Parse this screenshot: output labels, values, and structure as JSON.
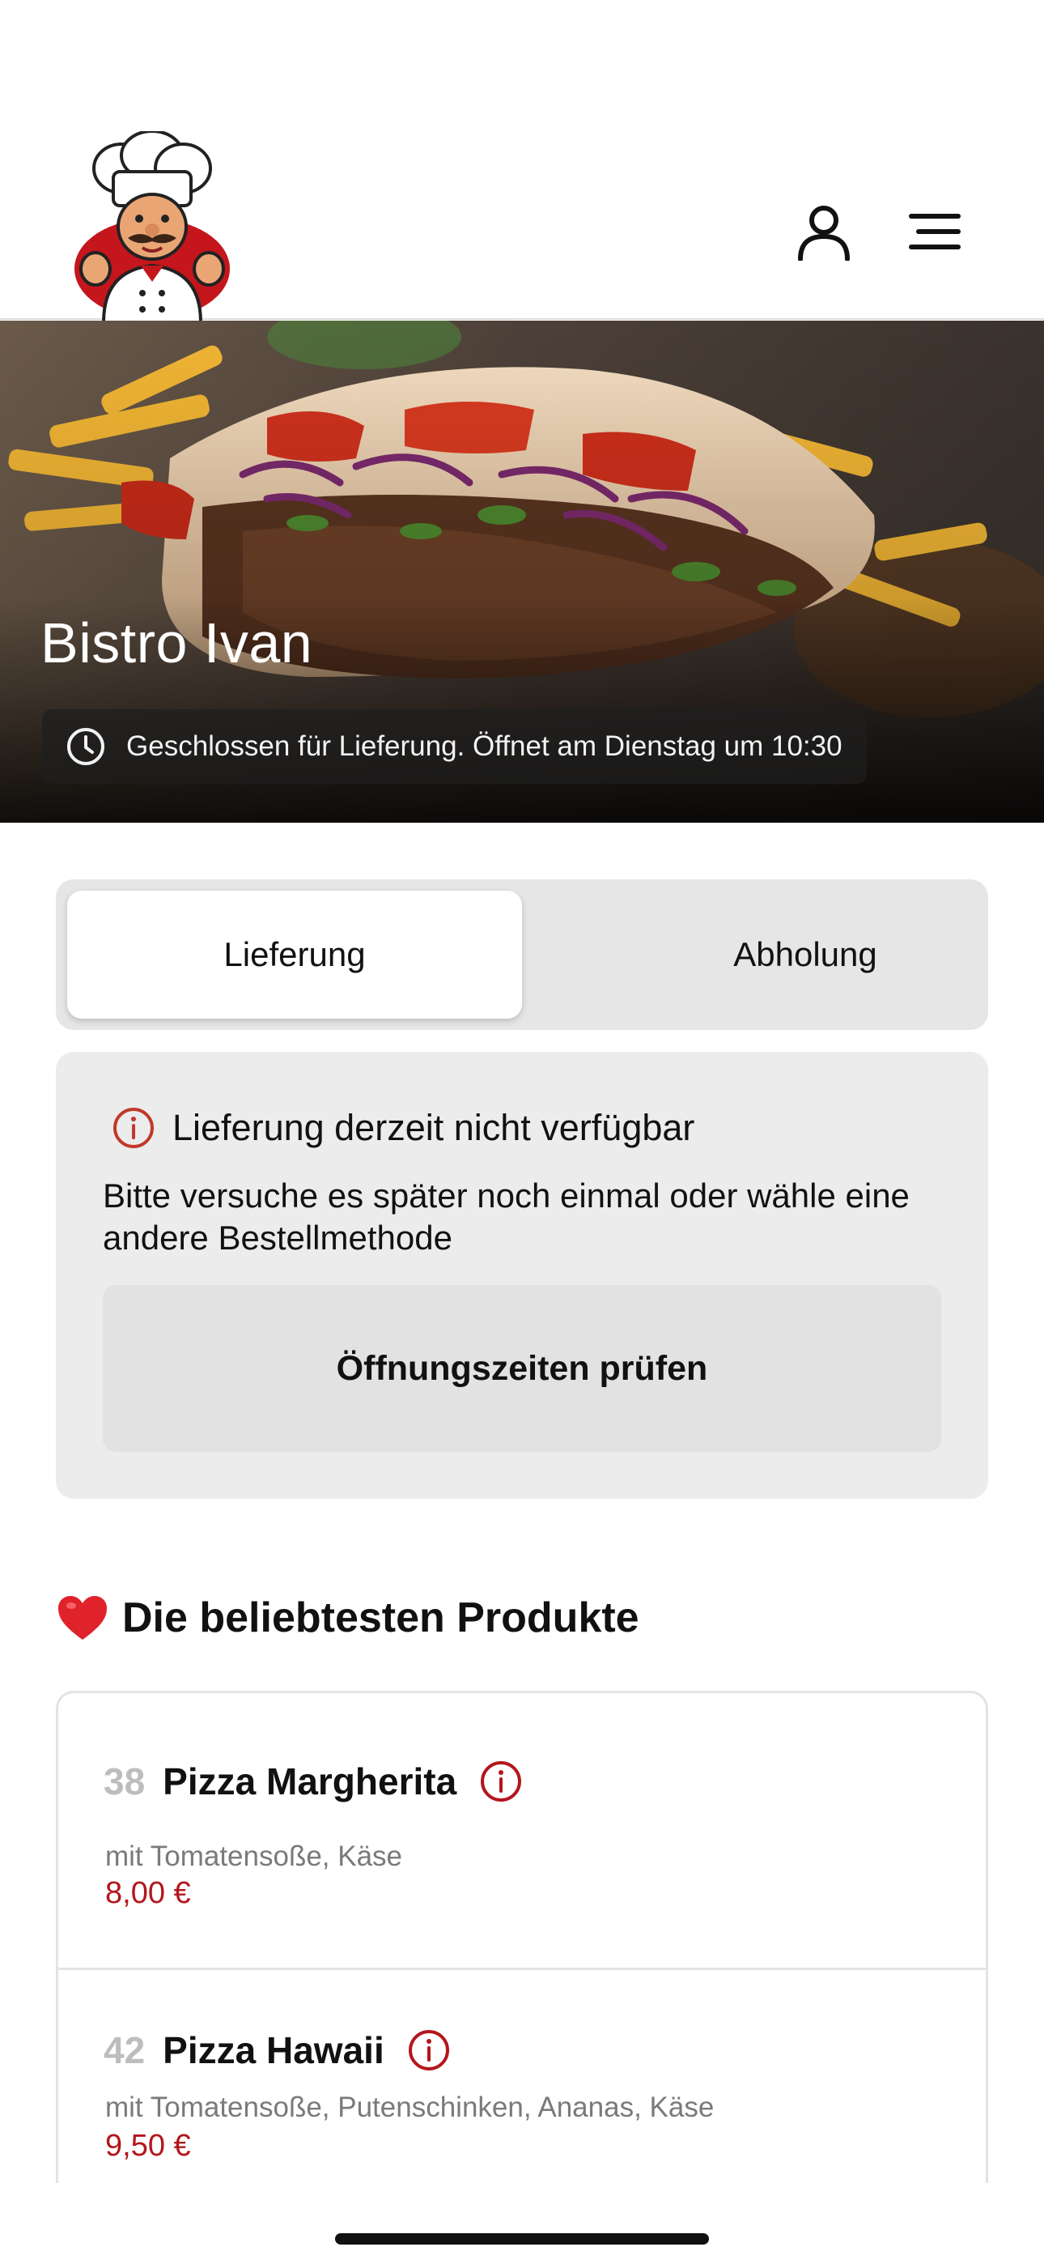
{
  "header": {
    "logo_icon": "chef-mascot-logo",
    "account_icon": "user-icon",
    "menu_icon": "hamburger-menu-icon"
  },
  "hero": {
    "restaurant_name": "Bistro Ivan",
    "status_icon": "clock-icon",
    "status_text": "Geschlossen für Lieferung. Öffnet am Dienstag um 10:30"
  },
  "order_mode": {
    "tabs": [
      {
        "label": "Lieferung",
        "selected": true
      },
      {
        "label": "Abholung",
        "selected": false
      }
    ]
  },
  "notice": {
    "icon": "info-icon",
    "title": "Lieferung derzeit nicht verfügbar",
    "text": "Bitte versuche es später noch einmal oder wähle eine andere Bestellmethode",
    "button_label": "Öffnungszeiten prüfen"
  },
  "popular": {
    "icon": "heart-icon",
    "title": "Die beliebtesten Produkte",
    "products": [
      {
        "number": "38",
        "name": "Pizza Margherita",
        "description": "mit Tomatensoße, Käse",
        "price": "8,00 €"
      },
      {
        "number": "42",
        "name": "Pizza Hawaii",
        "description": "mit Tomatensoße, Putenschinken, Ananas, Käse",
        "price": "9,50 €"
      }
    ]
  },
  "colors": {
    "accent": "#b3161c",
    "segment_bg": "#e6e6e6",
    "card_bg": "#ececec"
  }
}
